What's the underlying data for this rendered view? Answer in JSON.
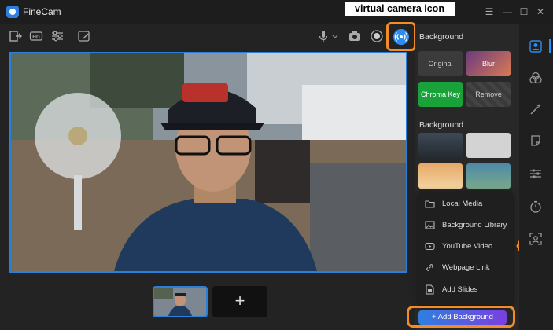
{
  "app": {
    "title": "FineCam"
  },
  "annotation": {
    "label": "virtual camera icon"
  },
  "window_controls": {
    "menu": "☰",
    "minimize": "—",
    "maximize": "☐",
    "close": "✕"
  },
  "toolbar": {
    "left_icons": [
      "exit-icon",
      "hd-icon",
      "adjust-icon",
      "draw-icon"
    ],
    "right_icons": [
      "microphone-icon",
      "camera-icon",
      "record-icon",
      "virtual-camera-icon"
    ]
  },
  "panel": {
    "header": "Background",
    "mode_tiles": [
      {
        "label": "Original"
      },
      {
        "label": "Blur"
      },
      {
        "label": "Chroma Key"
      },
      {
        "label": "Remove"
      }
    ],
    "library_header": "Background"
  },
  "dropdown": {
    "items": [
      {
        "label": "Local Media",
        "icon": "folder-icon"
      },
      {
        "label": "Background Library",
        "icon": "image-icon"
      },
      {
        "label": "YouTube Video",
        "icon": "youtube-icon"
      },
      {
        "label": "Webpage Link",
        "icon": "link-icon"
      },
      {
        "label": "Add Slides",
        "icon": "slides-icon"
      }
    ]
  },
  "add_background": {
    "label": "+ Add Background"
  },
  "add_scene": {
    "label": "+"
  },
  "colors": {
    "accent": "#2c8cf0",
    "highlight": "#f28c28",
    "chroma": "#1aa23a"
  }
}
